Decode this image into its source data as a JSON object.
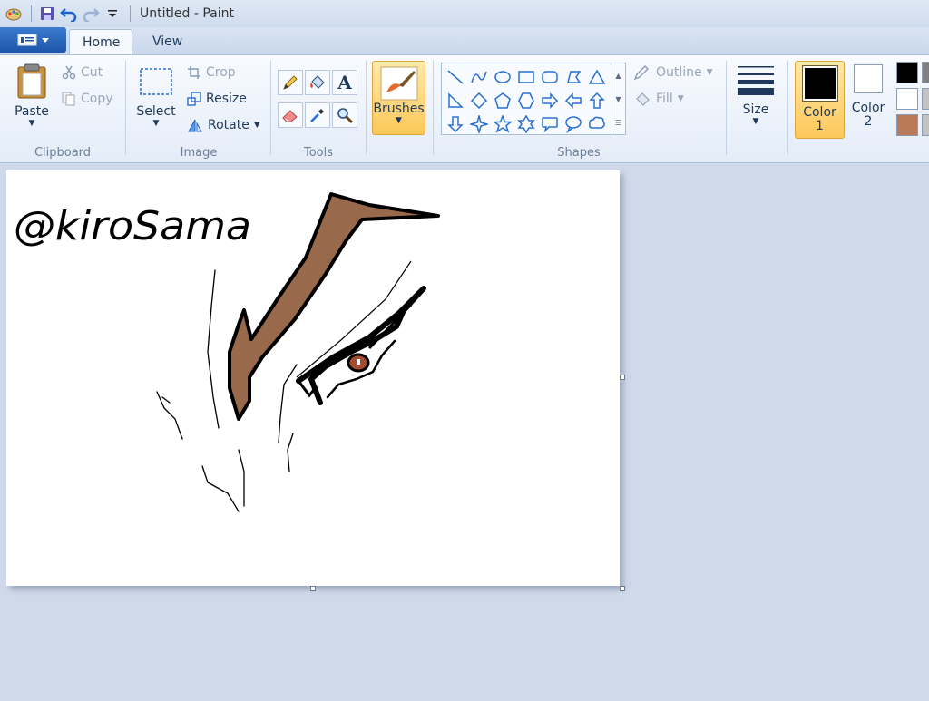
{
  "window": {
    "title": "Untitled - Paint"
  },
  "quick_access": {
    "icons": [
      "paint-app-icon",
      "save-icon",
      "undo-icon",
      "redo-icon",
      "customize-dropdown-icon"
    ]
  },
  "tabs": [
    {
      "label": "Home",
      "active": true
    },
    {
      "label": "View",
      "active": false
    }
  ],
  "ribbon": {
    "clipboard": {
      "label": "Clipboard",
      "paste": "Paste",
      "cut": "Cut",
      "copy": "Copy"
    },
    "image": {
      "label": "Image",
      "select": "Select",
      "crop": "Crop",
      "resize": "Resize",
      "rotate": "Rotate"
    },
    "tools": {
      "label": "Tools",
      "items": [
        "pencil-icon",
        "fill-icon",
        "text-icon",
        "eraser-icon",
        "color-picker-icon",
        "magnifier-icon"
      ]
    },
    "brushes": {
      "label": "Brushes"
    },
    "shapes": {
      "label": "Shapes",
      "outline": "Outline",
      "fill": "Fill",
      "items": [
        "line",
        "curve",
        "oval",
        "rectangle",
        "rounded-rectangle",
        "polygon",
        "triangle",
        "right-triangle",
        "diamond",
        "pentagon",
        "hexagon",
        "right-arrow",
        "left-arrow",
        "up-arrow",
        "down-arrow",
        "four-point-star",
        "five-point-star",
        "six-point-star",
        "rounded-callout",
        "oval-callout",
        "cloud-callout"
      ]
    },
    "size": {
      "label": "Size"
    },
    "color1": {
      "label": "Color",
      "number": "1",
      "color": "#000000"
    },
    "color2": {
      "label": "Color",
      "number": "2",
      "color": "#ffffff"
    },
    "palette": [
      "#000000",
      "#7f7f7f",
      "#ffffff",
      "#c3c3c3",
      "#b97a57",
      "#c3c3c3"
    ]
  },
  "canvas": {
    "watermark_text": "@kiroSama",
    "colors": {
      "brow": "#98694b",
      "ink": "#000000",
      "iris": "#a44a2e"
    }
  }
}
